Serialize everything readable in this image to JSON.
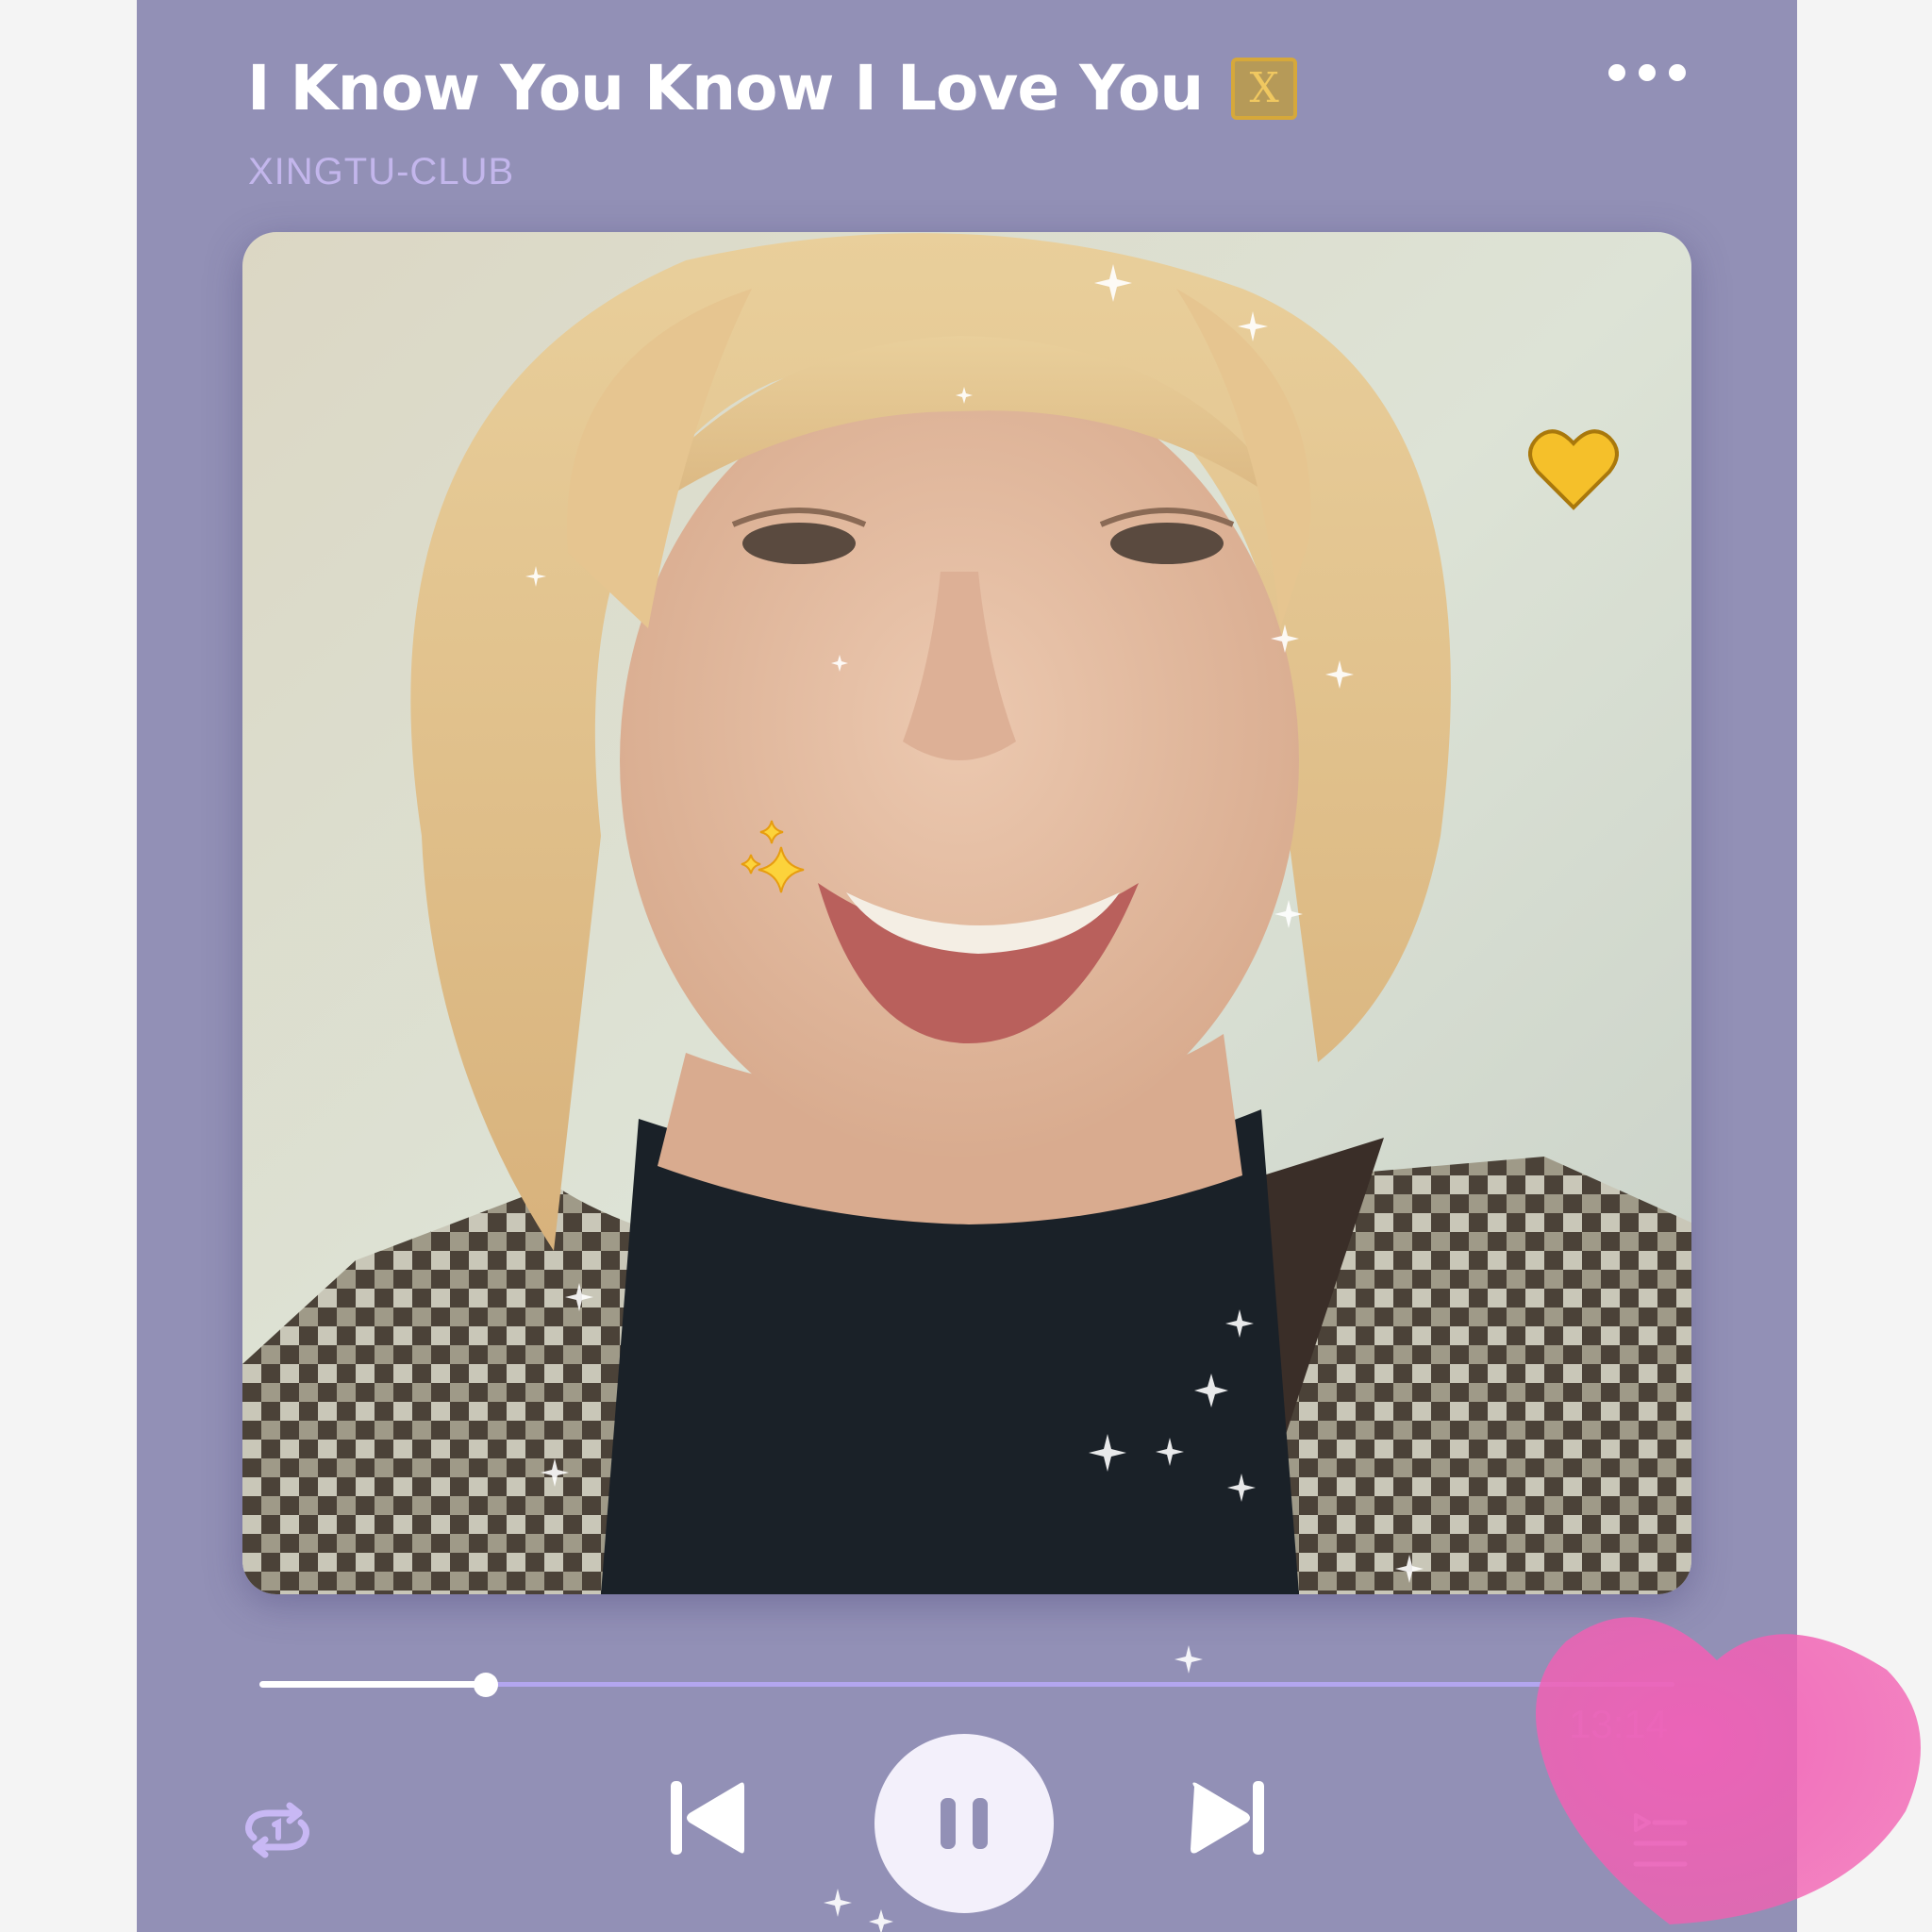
{
  "song": {
    "title": "I Know You Know I Love You",
    "badge": "X",
    "artist": "XINGTU-CLUB"
  },
  "cover": {
    "description_icon": "portrait-photo",
    "sticker_icons": [
      "yellow-heart-icon",
      "sparkles-icon"
    ]
  },
  "playback": {
    "progress": 0.16,
    "duration": "13:14"
  },
  "controls": {
    "repeat_icon": "repeat-one-icon",
    "prev_icon": "skip-previous-icon",
    "play_icon": "pause-icon",
    "next_icon": "skip-next-icon",
    "queue_icon": "playlist-icon",
    "more_icon": "more-dots-icon"
  },
  "colors": {
    "panel": "#9290b6",
    "accent": "#b3a6ef",
    "artist": "#c3b6ec",
    "badge": "#d6a83a"
  }
}
